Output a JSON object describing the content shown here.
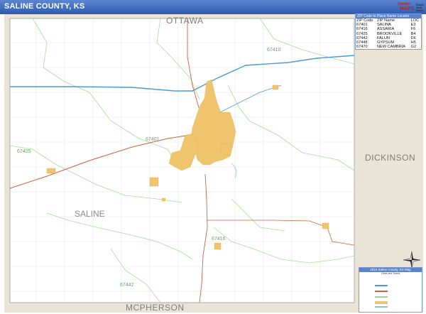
{
  "title": "SALINE COUNTY, KS",
  "logo": {
    "line1": "Market",
    "line2": "MAPS",
    "line3": "Small Wall Maps"
  },
  "labels": {
    "ottawa": "OTTAWA",
    "dickinson": "DICKINSON",
    "mcpherson": "MCPHERSON",
    "saline": "SALINE"
  },
  "zip_labels": {
    "z67410_top": "67410",
    "z67401": "67401",
    "z67425": "67425",
    "z67416": "67416",
    "z67442": "67442"
  },
  "zip_table": {
    "header": "ZIP Code to Place Name Locator",
    "columns": [
      "ZIP Code",
      "ZIP Name",
      "LOC"
    ],
    "rows": [
      [
        "67401",
        "SALINA",
        "E3"
      ],
      [
        "67416",
        "ASSARIA",
        "F6"
      ],
      [
        "67425",
        "BROOKVILLE",
        "B4"
      ],
      [
        "67442",
        "FALUN",
        "D6"
      ],
      [
        "67448",
        "GYPSUM",
        "H5"
      ],
      [
        "67470",
        "NEW CAMBRIA",
        "G2"
      ]
    ]
  },
  "legend": {
    "header": "2016 Saline County, KS Map",
    "subheader": "Cities and Towns"
  },
  "colors": {
    "title_bar": "#3a66b8",
    "land": "#eae4d6",
    "urban": "#efc46d",
    "zip_boundary": "#9fd88f",
    "highway": "#d05a3a",
    "interstate": "#3c8fd0"
  },
  "icons": {
    "compass": "compass-rose-icon"
  }
}
